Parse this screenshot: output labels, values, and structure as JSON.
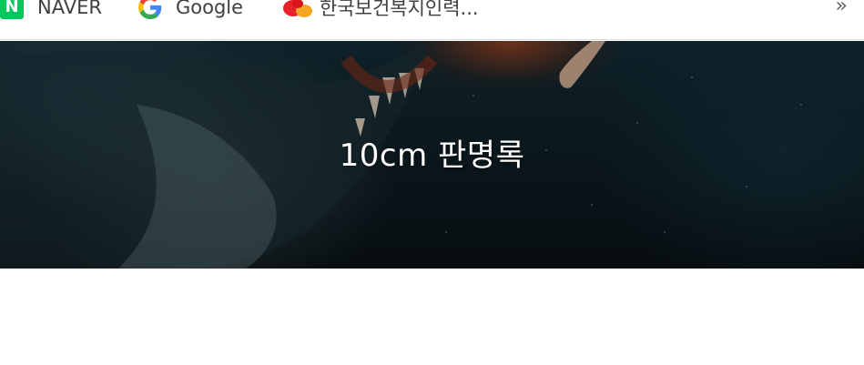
{
  "bookmarks": [
    {
      "label": "NAVER",
      "icon": "naver-icon"
    },
    {
      "label": "Google",
      "icon": "google-icon"
    },
    {
      "label": "한국보건복지인력...",
      "icon": "kuhrdi-icon"
    }
  ],
  "bookmarks_more": "»",
  "hero": {
    "title": "10cm 판명록"
  },
  "colors": {
    "naver_green": "#03c75a",
    "hero_dark": "#0b181d",
    "hero_glow": "#8c3714"
  }
}
